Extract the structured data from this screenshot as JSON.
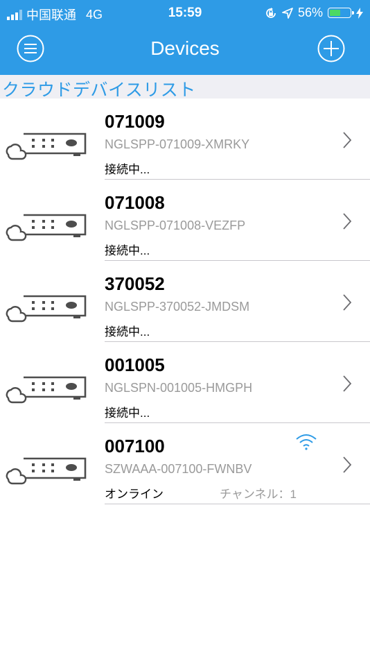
{
  "status_bar": {
    "carrier": "中国联通",
    "network": "4G",
    "time": "15:59",
    "battery_text": "56%",
    "battery_level": 0.56,
    "battery_color": "#4cd964"
  },
  "navbar": {
    "title": "Devices",
    "menu_icon": "menu-circle-icon",
    "add_icon": "plus-circle-icon",
    "background": "#2e9be6"
  },
  "section": {
    "title": "クラウドデバイスリスト"
  },
  "devices": [
    {
      "name": "071009",
      "serial": "NGLSPP-071009-XMRKY",
      "status": "接続中...",
      "channel": ""
    },
    {
      "name": "071008",
      "serial": "NGLSPP-071008-VEZFP",
      "status": "接続中...",
      "channel": ""
    },
    {
      "name": "370052",
      "serial": "NGLSPP-370052-JMDSM",
      "status": "接続中...",
      "channel": ""
    },
    {
      "name": "001005",
      "serial": "NGLSPN-001005-HMGPH",
      "status": "接続中...",
      "channel": ""
    },
    {
      "name": "007100",
      "serial": "SZWAAA-007100-FWNBV",
      "status": "オンライン",
      "channel": "チャンネル：1",
      "wifi_icon": "wifi-icon"
    }
  ]
}
